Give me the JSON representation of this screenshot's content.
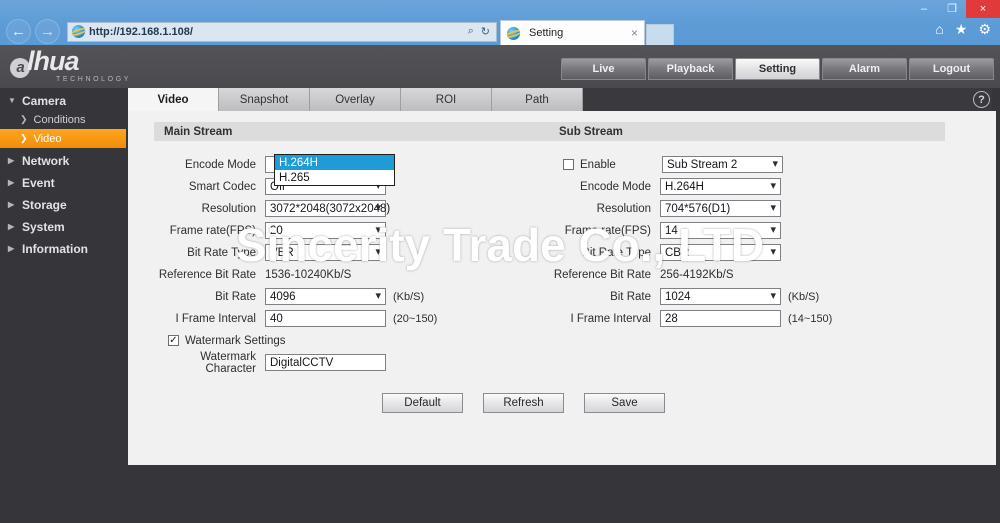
{
  "browser": {
    "url": "http://192.168.1.108/",
    "tab_title": "Setting",
    "tab_close": "×",
    "back_arrow": "←",
    "forward_arrow": "→",
    "search_icon": "⌕",
    "refresh_icon": "↻",
    "home_icon": "⌂",
    "favorites_icon": "★",
    "tools_icon": "⚙",
    "minimize": "–",
    "maximize": "❐",
    "close": "×"
  },
  "header": {
    "logo_text": "lhua",
    "logo_mark": "a",
    "logo_sub": "TECHNOLOGY",
    "nav": [
      {
        "label": "Live",
        "active": false
      },
      {
        "label": "Playback",
        "active": false
      },
      {
        "label": "Setting",
        "active": true
      },
      {
        "label": "Alarm",
        "active": false
      },
      {
        "label": "Logout",
        "active": false
      }
    ]
  },
  "sidebar": {
    "items": [
      {
        "label": "Camera",
        "type": "top",
        "icon": "▼",
        "active": false
      },
      {
        "label": "Conditions",
        "type": "sub",
        "icon": "❯",
        "active": false
      },
      {
        "label": "Video",
        "type": "sub",
        "icon": "❯",
        "active": true
      },
      {
        "label": "Network",
        "type": "top",
        "icon": "▶",
        "active": false
      },
      {
        "label": "Event",
        "type": "top",
        "icon": "▶",
        "active": false
      },
      {
        "label": "Storage",
        "type": "top",
        "icon": "▶",
        "active": false
      },
      {
        "label": "System",
        "type": "top",
        "icon": "▶",
        "active": false
      },
      {
        "label": "Information",
        "type": "top",
        "icon": "▶",
        "active": false
      }
    ]
  },
  "tabs": [
    {
      "label": "Video",
      "active": true
    },
    {
      "label": "Snapshot",
      "active": false
    },
    {
      "label": "Overlay",
      "active": false
    },
    {
      "label": "ROI",
      "active": false
    },
    {
      "label": "Path",
      "active": false
    }
  ],
  "help_icon": "?",
  "main_stream": {
    "title": "Main Stream",
    "encode_mode_label": "Encode Mode",
    "encode_mode_options": [
      "H.264H",
      "H.265"
    ],
    "encode_mode_selected": "H.264H",
    "smart_codec_label": "Smart Codec",
    "smart_codec_value": "Off",
    "resolution_label": "Resolution",
    "resolution_value": "3072*2048(3072x2048)",
    "frame_rate_label": "Frame rate(FPS)",
    "frame_rate_value": "20",
    "bit_rate_type_label": "Bit Rate Type",
    "bit_rate_type_value": "VBR",
    "reference_bit_rate_label": "Reference Bit Rate",
    "reference_bit_rate_value": "1536-10240Kb/S",
    "bit_rate_label": "Bit Rate",
    "bit_rate_value": "4096",
    "bit_rate_unit": "(Kb/S)",
    "i_frame_label": "I Frame Interval",
    "i_frame_value": "40",
    "i_frame_range": "(20~150)",
    "watermark_settings_label": "Watermark Settings",
    "watermark_settings_checked": "✓",
    "watermark_char_label": "Watermark Character",
    "watermark_char_value": "DigitalCCTV"
  },
  "sub_stream": {
    "title": "Sub Stream",
    "enable_label": "Enable",
    "enable_checked": "",
    "stream_select_value": "Sub Stream 2",
    "encode_mode_label": "Encode Mode",
    "encode_mode_value": "H.264H",
    "resolution_label": "Resolution",
    "resolution_value": "704*576(D1)",
    "frame_rate_label": "Frame rate(FPS)",
    "frame_rate_value": "14",
    "bit_rate_type_label": "Bit Rate Type",
    "bit_rate_type_value": "CBR",
    "reference_bit_rate_label": "Reference Bit Rate",
    "reference_bit_rate_value": "256-4192Kb/S",
    "bit_rate_label": "Bit Rate",
    "bit_rate_value": "1024",
    "bit_rate_unit": "(Kb/S)",
    "i_frame_label": "I Frame Interval",
    "i_frame_value": "28",
    "i_frame_range": "(14~150)"
  },
  "buttons": {
    "default": "Default",
    "refresh": "Refresh",
    "save": "Save"
  },
  "overlay_watermark": "Sincerity Trade Co., LTD"
}
